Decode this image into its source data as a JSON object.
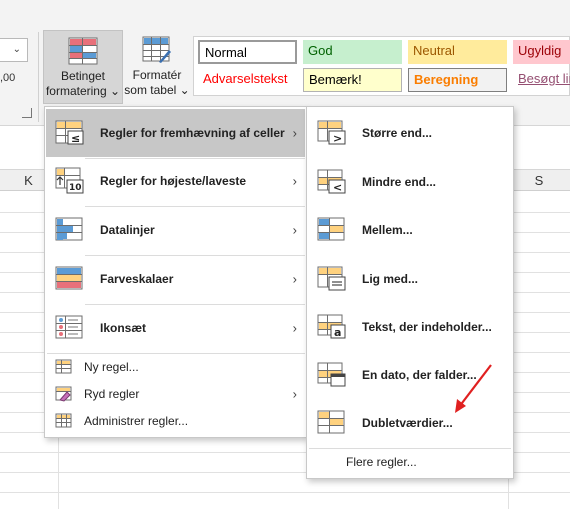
{
  "ribbon": {
    "cond_format": {
      "line1": "Betinget",
      "line2": "formatering"
    },
    "format_table": {
      "line1": "Formatér",
      "line2": "som tabel"
    },
    "left_stub_text": ",00",
    "styles": [
      {
        "label": "Normal",
        "bg": "#ffffff",
        "fg": "#000000",
        "border": "#9a9a9a"
      },
      {
        "label": "God",
        "bg": "#c6efce",
        "fg": "#006100",
        "border": "#c6efce"
      },
      {
        "label": "Neutral",
        "bg": "#ffeb9c",
        "fg": "#9c5700",
        "border": "#ffeb9c"
      },
      {
        "label": "Ugyldig",
        "bg": "#ffc7ce",
        "fg": "#9c0006",
        "border": "#ffc7ce"
      },
      {
        "label": "Advarselstekst",
        "bg": "#ffffff",
        "fg": "#ff0000",
        "border": "#ffffff"
      },
      {
        "label": "Bemærk!",
        "bg": "#ffffcc",
        "fg": "#000000",
        "border": "#b2b2b2"
      },
      {
        "label": "Beregning",
        "bg": "#f2f2f2",
        "fg": "#fa7d00",
        "border": "#7f7f7f"
      },
      {
        "label": "Besøgt lin",
        "bg": "#ffffff",
        "fg": "#954f72",
        "border": "#ffffff"
      }
    ]
  },
  "sheet": {
    "columns": [
      "K",
      "S"
    ]
  },
  "menu1": {
    "items": [
      {
        "label": "Regler for fremhævning af celler",
        "icon": "highlight-cells-rules-icon",
        "submenu": true
      },
      {
        "label": "Regler for højeste/laveste",
        "icon": "top-bottom-rules-icon",
        "submenu": true
      },
      {
        "label": "Datalinjer",
        "icon": "data-bars-icon",
        "submenu": true
      },
      {
        "label": "Farveskalaer",
        "icon": "color-scales-icon",
        "submenu": true
      },
      {
        "label": "Ikonsæt",
        "icon": "icon-sets-icon",
        "submenu": true
      }
    ],
    "small_items": [
      {
        "label": "Ny regel...",
        "icon": "new-rule-icon"
      },
      {
        "label": "Ryd regler",
        "icon": "clear-rules-icon"
      },
      {
        "label": "Administrer regler...",
        "icon": "manage-rules-icon"
      }
    ]
  },
  "menu2": {
    "items": [
      {
        "label": "Større end...",
        "icon": "greater-than-icon"
      },
      {
        "label": "Mindre end...",
        "icon": "less-than-icon"
      },
      {
        "label": "Mellem...",
        "icon": "between-icon"
      },
      {
        "label": "Lig med...",
        "icon": "equal-to-icon"
      },
      {
        "label": "Tekst, der indeholder...",
        "icon": "text-contains-icon"
      },
      {
        "label": "En dato, der falder...",
        "icon": "date-occurring-icon"
      },
      {
        "label": "Dubletværdier...",
        "icon": "duplicate-values-icon"
      }
    ],
    "more": "Flere regler..."
  }
}
